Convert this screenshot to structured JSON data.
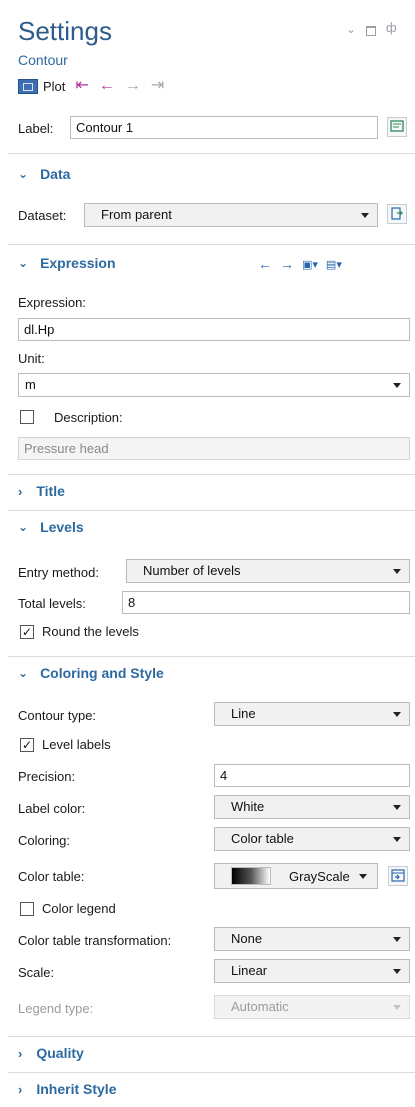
{
  "header": {
    "title": "Settings",
    "subtitle": "Contour",
    "plot_label": "Plot"
  },
  "label_field": {
    "label": "Label:",
    "value": "Contour 1"
  },
  "sections": {
    "data": "Data",
    "expression": "Expression",
    "title": "Title",
    "levels": "Levels",
    "coloring": "Coloring and Style",
    "quality": "Quality",
    "inherit": "Inherit Style"
  },
  "data": {
    "dataset_label": "Dataset:",
    "dataset_value": "From parent"
  },
  "expression": {
    "expression_label": "Expression:",
    "expression_value": "dl.Hp",
    "unit_label": "Unit:",
    "unit_value": "m",
    "description_label": "Description:",
    "description_checked": false,
    "description_value": "Pressure head"
  },
  "levels": {
    "entry_method_label": "Entry method:",
    "entry_method_value": "Number of levels",
    "total_levels_label": "Total levels:",
    "total_levels_value": "8",
    "round_label": "Round the levels",
    "round_checked": true
  },
  "coloring": {
    "contour_type_label": "Contour type:",
    "contour_type_value": "Line",
    "level_labels_label": "Level labels",
    "level_labels_checked": true,
    "precision_label": "Precision:",
    "precision_value": "4",
    "label_color_label": "Label color:",
    "label_color_value": "White",
    "coloring_label": "Coloring:",
    "coloring_value": "Color table",
    "color_table_label": "Color table:",
    "color_table_value": "GrayScale",
    "color_legend_label": "Color legend",
    "color_legend_checked": false,
    "transformation_label": "Color table transformation:",
    "transformation_value": "None",
    "scale_label": "Scale:",
    "scale_value": "Linear",
    "legend_type_label": "Legend type:",
    "legend_type_value": "Automatic"
  },
  "colors": {
    "accent": "#2d6aa0",
    "title": "#2d5b8a",
    "nav_active": "#b4329b"
  }
}
